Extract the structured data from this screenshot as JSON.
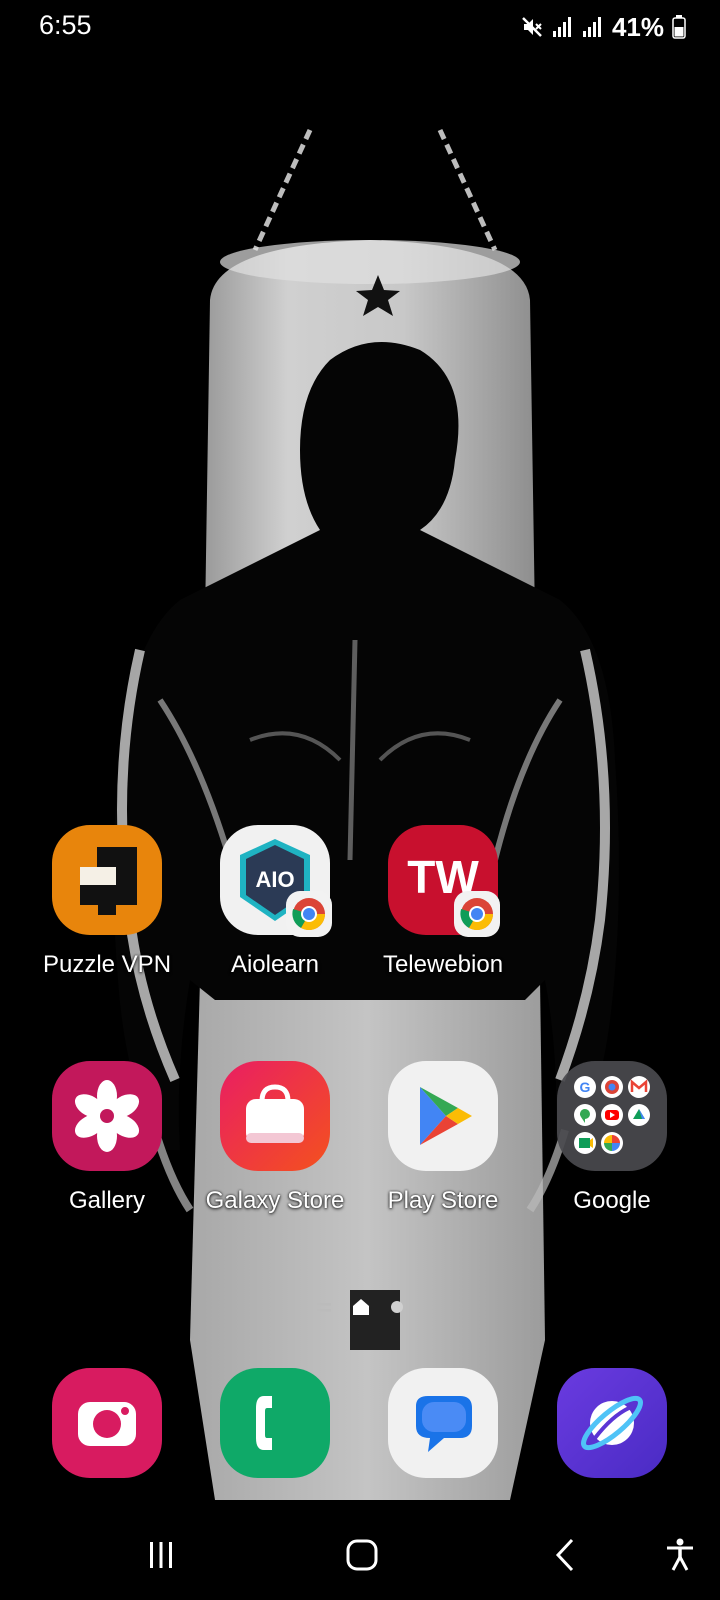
{
  "status_bar": {
    "time": "6:55",
    "battery_percent": "41%",
    "icons": [
      "mute-icon",
      "signal-icon",
      "signal-icon",
      "battery-icon"
    ]
  },
  "home": {
    "row1": [
      {
        "label": "Puzzle VPN",
        "icon": "puzzle-vpn-icon",
        "color": "#E8850C"
      },
      {
        "label": "Aiolearn",
        "icon": "aiolearn-icon",
        "icon_text": "AIO",
        "color": "#2B3A55",
        "badge": "chrome-badge-icon"
      },
      {
        "label": "Telewebion",
        "icon": "telewebion-icon",
        "icon_text": "TW",
        "color": "#C8102E",
        "badge": "chrome-badge-icon"
      }
    ],
    "row2": [
      {
        "label": "Gallery",
        "icon": "gallery-icon",
        "color": "#C2185B"
      },
      {
        "label": "Galaxy Store",
        "icon": "galaxy-store-icon",
        "color": "#E91E63"
      },
      {
        "label": "Play Store",
        "icon": "play-store-icon",
        "color": "#F1F1F1"
      },
      {
        "label": "Google",
        "icon": "google-folder-icon",
        "color": "#4A4A4E"
      }
    ],
    "page_indicator": {
      "pages": 2,
      "current": "home",
      "icons": [
        "feed-icon",
        "home-page-icon",
        "page-dot-icon"
      ]
    }
  },
  "dock": [
    {
      "icon": "camera-icon",
      "color": "#D81B60"
    },
    {
      "icon": "phone-icon",
      "color": "#0FA968"
    },
    {
      "icon": "messages-icon",
      "color": "#F1F1F1"
    },
    {
      "icon": "internet-icon",
      "color": "#5B35D5"
    }
  ],
  "nav_bar": {
    "buttons": [
      "recent-apps-icon",
      "home-icon",
      "back-icon",
      "accessibility-icon"
    ]
  }
}
